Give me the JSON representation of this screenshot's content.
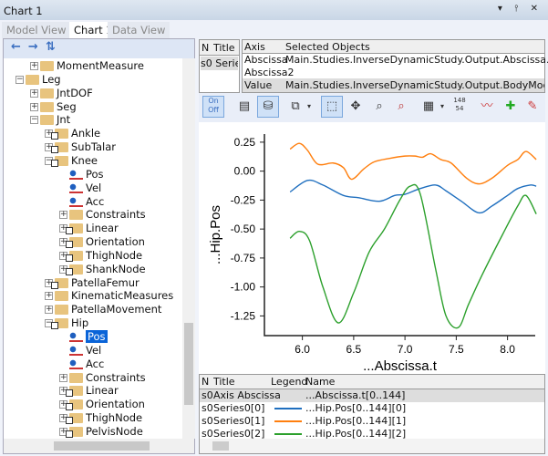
{
  "window": {
    "title": "Chart 1",
    "controls": "▾ ⫯ ✕"
  },
  "tabs": [
    {
      "label": "Model View 1"
    },
    {
      "label": "Chart 1"
    },
    {
      "label": "Data View"
    }
  ],
  "tree_toolbar": {
    "back": "←",
    "forward": "→",
    "sort": "⇅"
  },
  "tree": [
    {
      "label": "MomentMeasure",
      "level": 2,
      "type": "folder",
      "exp": "+"
    },
    {
      "label": "Leg",
      "level": 1,
      "type": "folder",
      "exp": "−"
    },
    {
      "label": "JntDOF",
      "level": 2,
      "type": "folder",
      "exp": "+"
    },
    {
      "label": "Seg",
      "level": 2,
      "type": "folder",
      "exp": "+"
    },
    {
      "label": "Jnt",
      "level": 2,
      "type": "folder",
      "exp": "−"
    },
    {
      "label": "Ankle",
      "level": 3,
      "type": "ref",
      "exp": "+"
    },
    {
      "label": "SubTalar",
      "level": 3,
      "type": "ref",
      "exp": "+"
    },
    {
      "label": "Knee",
      "level": 3,
      "type": "ref",
      "exp": "−"
    },
    {
      "label": "Pos",
      "level": 4,
      "type": "leaf"
    },
    {
      "label": "Vel",
      "level": 4,
      "type": "leaf"
    },
    {
      "label": "Acc",
      "level": 4,
      "type": "leaf"
    },
    {
      "label": "Constraints",
      "level": 4,
      "type": "folder",
      "exp": "+"
    },
    {
      "label": "Linear",
      "level": 4,
      "type": "ref",
      "exp": "+"
    },
    {
      "label": "Orientation",
      "level": 4,
      "type": "ref",
      "exp": "+"
    },
    {
      "label": "ThighNode",
      "level": 4,
      "type": "ref",
      "exp": "+"
    },
    {
      "label": "ShankNode",
      "level": 4,
      "type": "ref",
      "exp": "+"
    },
    {
      "label": "PatellaFemur",
      "level": 3,
      "type": "ref",
      "exp": "+"
    },
    {
      "label": "KinematicMeasures",
      "level": 3,
      "type": "folder",
      "exp": "+"
    },
    {
      "label": "PatellaMovement",
      "level": 3,
      "type": "folder",
      "exp": "+"
    },
    {
      "label": "Hip",
      "level": 3,
      "type": "ref",
      "exp": "−"
    },
    {
      "label": "Pos",
      "level": 4,
      "type": "leaf",
      "selected": true
    },
    {
      "label": "Vel",
      "level": 4,
      "type": "leaf"
    },
    {
      "label": "Acc",
      "level": 4,
      "type": "leaf"
    },
    {
      "label": "Constraints",
      "level": 4,
      "type": "folder",
      "exp": "+"
    },
    {
      "label": "Linear",
      "level": 4,
      "type": "ref",
      "exp": "+"
    },
    {
      "label": "Orientation",
      "level": 4,
      "type": "ref",
      "exp": "+"
    },
    {
      "label": "ThighNode",
      "level": 4,
      "type": "ref",
      "exp": "+"
    },
    {
      "label": "PelvisNode",
      "level": 4,
      "type": "ref",
      "exp": "+"
    }
  ],
  "series_grid": {
    "headers": [
      "N",
      "Title"
    ],
    "rows": [
      [
        "s0",
        "Series"
      ]
    ]
  },
  "axis_grid": {
    "headers": [
      "Axis",
      "Selected Objects"
    ],
    "rows": [
      [
        "Abscissa",
        "Main.Studies.InverseDynamicStudy.Output.Abscissa.t"
      ],
      [
        "Abscissa2",
        ""
      ],
      [
        "Value",
        "Main.Studies.InverseDynamicStudy.Output.BodyModel.Right.Leg"
      ]
    ]
  },
  "toolbar": {
    "onoff_top": "On",
    "onoff_bottom": "Off",
    "badge_top": "148",
    "badge_bottom": "54"
  },
  "chart_data": {
    "type": "line",
    "xlabel": "...Abscissa.t",
    "ylabel": "...Hip.Pos",
    "xlim": [
      5.63,
      8.27
    ],
    "ylim": [
      -1.42,
      0.32
    ],
    "xticks": [
      6.0,
      6.5,
      7.0,
      7.5,
      8.0
    ],
    "xtick_labels": [
      "6.0",
      "6.5",
      "7.0",
      "7.5",
      "8.0"
    ],
    "yticks": [
      0.25,
      0,
      -0.25,
      -0.5,
      -0.75,
      -1,
      -1.25
    ],
    "ytick_labels": [
      "0.25",
      "0.00",
      "-0.25",
      "-0.50",
      "-0.75",
      "-1.00",
      "-1.25"
    ],
    "grid": false,
    "series": [
      {
        "color": "#1f6fbf",
        "x": [
          5.88,
          6.05,
          6.2,
          6.4,
          6.55,
          6.75,
          6.9,
          7.0,
          7.15,
          7.3,
          7.4,
          7.55,
          7.72,
          7.85,
          8.0,
          8.1,
          8.22,
          8.28
        ],
        "y": [
          -0.18,
          -0.08,
          -0.12,
          -0.21,
          -0.23,
          -0.26,
          -0.21,
          -0.2,
          -0.15,
          -0.12,
          -0.17,
          -0.26,
          -0.36,
          -0.3,
          -0.21,
          -0.15,
          -0.12,
          -0.13
        ]
      },
      {
        "color": "#ff7f0e",
        "x": [
          5.88,
          5.97,
          6.05,
          6.15,
          6.3,
          6.4,
          6.48,
          6.6,
          6.7,
          6.85,
          7.0,
          7.1,
          7.17,
          7.25,
          7.35,
          7.45,
          7.6,
          7.72,
          7.85,
          8.0,
          8.1,
          8.18,
          8.28
        ],
        "y": [
          0.19,
          0.24,
          0.18,
          0.06,
          0.07,
          0.03,
          -0.07,
          0.02,
          0.08,
          0.11,
          0.13,
          0.13,
          0.12,
          0.15,
          0.1,
          0.07,
          -0.06,
          -0.11,
          -0.06,
          0.05,
          0.1,
          0.17,
          0.1
        ]
      },
      {
        "color": "#2ca02c",
        "x": [
          5.88,
          5.97,
          6.07,
          6.2,
          6.35,
          6.5,
          6.65,
          6.8,
          6.95,
          7.05,
          7.15,
          7.3,
          7.4,
          7.52,
          7.62,
          7.75,
          7.95,
          8.1,
          8.18,
          8.28
        ],
        "y": [
          -0.58,
          -0.52,
          -0.6,
          -1.0,
          -1.31,
          -1.05,
          -0.7,
          -0.5,
          -0.25,
          -0.13,
          -0.2,
          -0.85,
          -1.25,
          -1.35,
          -1.15,
          -0.9,
          -0.55,
          -0.3,
          -0.21,
          -0.37
        ]
      }
    ]
  },
  "legend_table": {
    "headers": [
      "N",
      "Title",
      "Legend",
      "Name"
    ],
    "rows": [
      {
        "n": "s0",
        "title": "Axis Abscissa",
        "color": "",
        "name": "...Abscissa.t[0..144]"
      },
      {
        "n": "s0",
        "title": "Series0[0]",
        "color": "#1f6fbf",
        "name": "...Hip.Pos[0..144][0]"
      },
      {
        "n": "s0",
        "title": "Series0[1]",
        "color": "#ff7f0e",
        "name": "...Hip.Pos[0..144][1]"
      },
      {
        "n": "s0",
        "title": "Series0[2]",
        "color": "#2ca02c",
        "name": "...Hip.Pos[0..144][2]"
      }
    ]
  }
}
